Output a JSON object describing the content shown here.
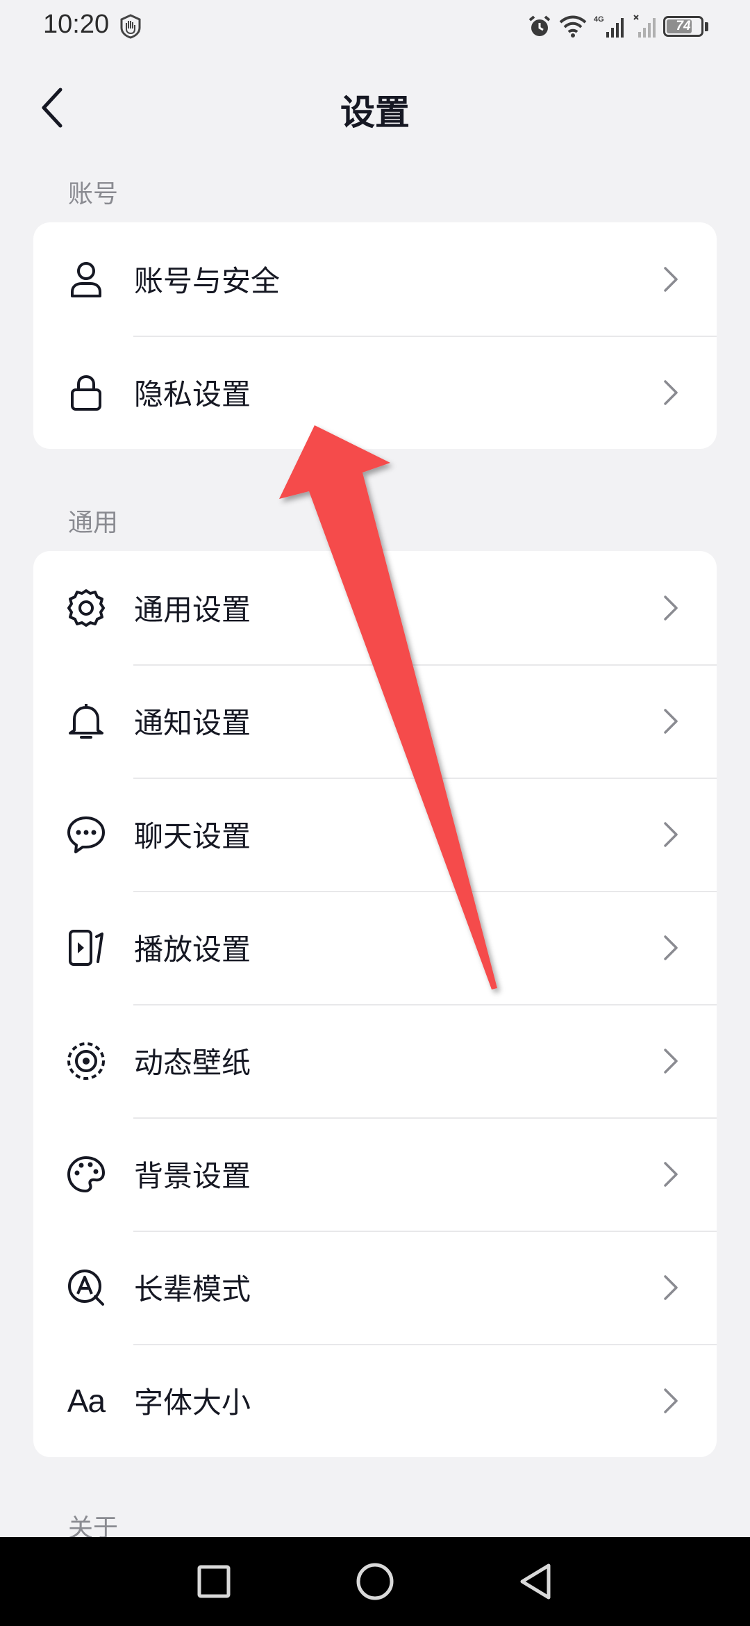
{
  "status_bar": {
    "time": "10:20",
    "battery": "74",
    "battery_level": 0.74,
    "network_label": "4G"
  },
  "header": {
    "title": "设置"
  },
  "sections": {
    "account": {
      "label": "账号",
      "items": [
        {
          "label": "账号与安全",
          "icon": "user-icon"
        },
        {
          "label": "隐私设置",
          "icon": "lock-icon"
        }
      ]
    },
    "general": {
      "label": "通用",
      "items": [
        {
          "label": "通用设置",
          "icon": "gear-icon"
        },
        {
          "label": "通知设置",
          "icon": "bell-icon"
        },
        {
          "label": "聊天设置",
          "icon": "chat-bubble-icon"
        },
        {
          "label": "播放设置",
          "icon": "play-screen-icon"
        },
        {
          "label": "动态壁纸",
          "icon": "live-wallpaper-icon"
        },
        {
          "label": "背景设置",
          "icon": "palette-icon"
        },
        {
          "label": "长辈模式",
          "icon": "elder-mode-icon"
        },
        {
          "label": "字体大小",
          "icon": "font-size-icon",
          "glyph": "Aa"
        }
      ]
    },
    "about": {
      "label": "关于"
    }
  },
  "colors": {
    "background": "#f2f2f4",
    "card": "#ffffff",
    "text_primary": "#161823",
    "text_secondary": "#8a8b91",
    "annotation_arrow": "#f54b4b"
  }
}
